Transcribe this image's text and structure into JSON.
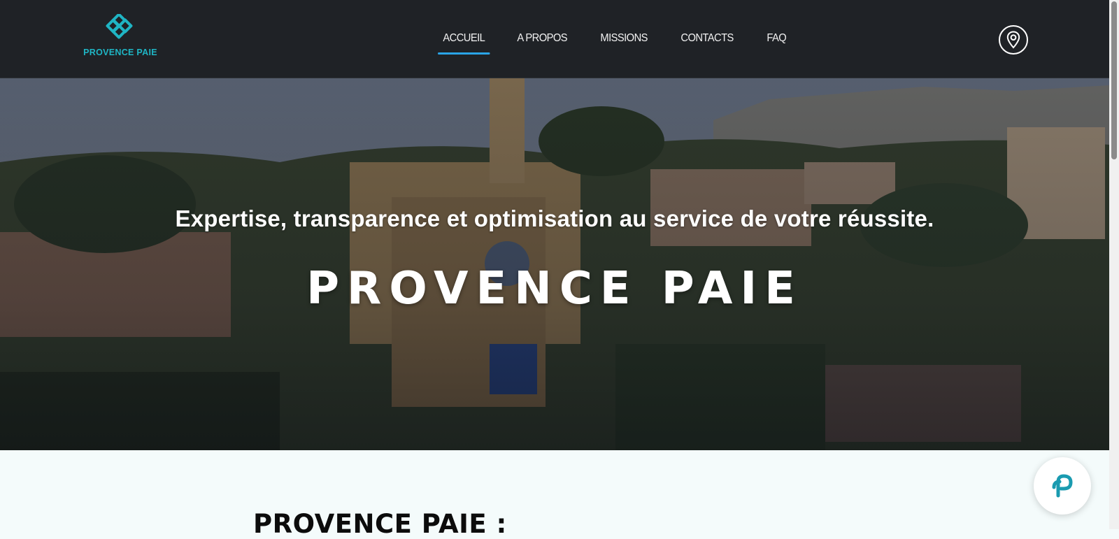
{
  "brand": {
    "name": "PROVENCE PAIE",
    "logo_icon": "diamond-knot-logo-icon",
    "accent": "#1fb5c4"
  },
  "nav": {
    "items": [
      {
        "label": "ACCUEIL",
        "active": true
      },
      {
        "label": "A PROPOS",
        "active": false
      },
      {
        "label": "MISSIONS",
        "active": false
      },
      {
        "label": "CONTACTS",
        "active": false
      },
      {
        "label": "FAQ",
        "active": false
      }
    ],
    "active_indicator_color": "#2aa4e6",
    "location_icon": "map-pin-icon"
  },
  "hero": {
    "tagline": "Expertise, transparence et optimisation au service de votre réussite.",
    "title": "PROVENCE PAIE",
    "background_image": "aerial view of a Provençal town with church bell tower"
  },
  "section": {
    "heading": "PROVENCE PAIE :"
  },
  "chat_widget": {
    "icon": "chat-widget-icon",
    "color": "#1a9bb0"
  },
  "colors": {
    "header_bg": "#1f2226",
    "page_bg": "#f4fbfb"
  }
}
